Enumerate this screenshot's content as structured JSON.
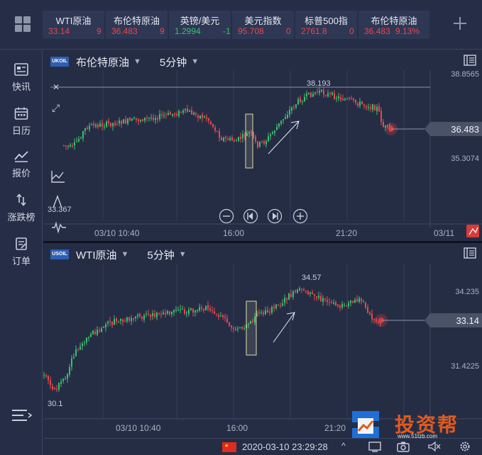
{
  "ticker": [
    {
      "name": "WTI原油",
      "value": "33.14",
      "change": "9",
      "dir": "up"
    },
    {
      "name": "布伦特原油",
      "value": "36.483",
      "change": "9",
      "dir": "up"
    },
    {
      "name": "英镑/美元",
      "value": "1.2994",
      "change": "-1",
      "dir": "dn"
    },
    {
      "name": "美元指数",
      "value": "95.708",
      "change": "0",
      "dir": "up"
    },
    {
      "name": "标普500指",
      "value": "2761.8",
      "change": "0",
      "dir": "up"
    },
    {
      "name": "布伦特原油",
      "value": "36.483",
      "change": "9.13%",
      "dir": "up"
    }
  ],
  "sidebar": {
    "items": [
      {
        "label": "快讯",
        "icon": "news-icon"
      },
      {
        "label": "日历",
        "icon": "calendar-icon"
      },
      {
        "label": "报价",
        "icon": "quote-chart-icon"
      },
      {
        "label": "涨跌榜",
        "icon": "up-down-arrows-icon"
      },
      {
        "label": "订单",
        "icon": "order-icon"
      }
    ]
  },
  "panel1": {
    "logo": "UKOIL",
    "symbol": "布伦特原油",
    "period": "5分钟",
    "price_high_label": "38.8565",
    "price_mid_label": "35.3074",
    "current_price": "36.483",
    "peak_label": "38.193",
    "low_label": "33.367",
    "time_labels": [
      "03/10 10:40",
      "16:00",
      "21:20",
      "03/11"
    ]
  },
  "panel2": {
    "logo": "USOIL",
    "symbol": "WTI原油",
    "period": "5分钟",
    "price_high_label": "34.235",
    "price_mid_label": "31.4225",
    "current_price": "33.14",
    "peak_label": "34.57",
    "low_label": "30.1",
    "time_labels": [
      "03/10 10:40",
      "16:00",
      "21:20"
    ]
  },
  "status": {
    "datetime": "2020-03-10 23:29:28"
  },
  "watermark": {
    "text": "投资帮",
    "url": "www.51tzb.com"
  },
  "colors": {
    "up": "#e8484d",
    "down": "#3bc06a",
    "bg": "#252d45"
  }
}
